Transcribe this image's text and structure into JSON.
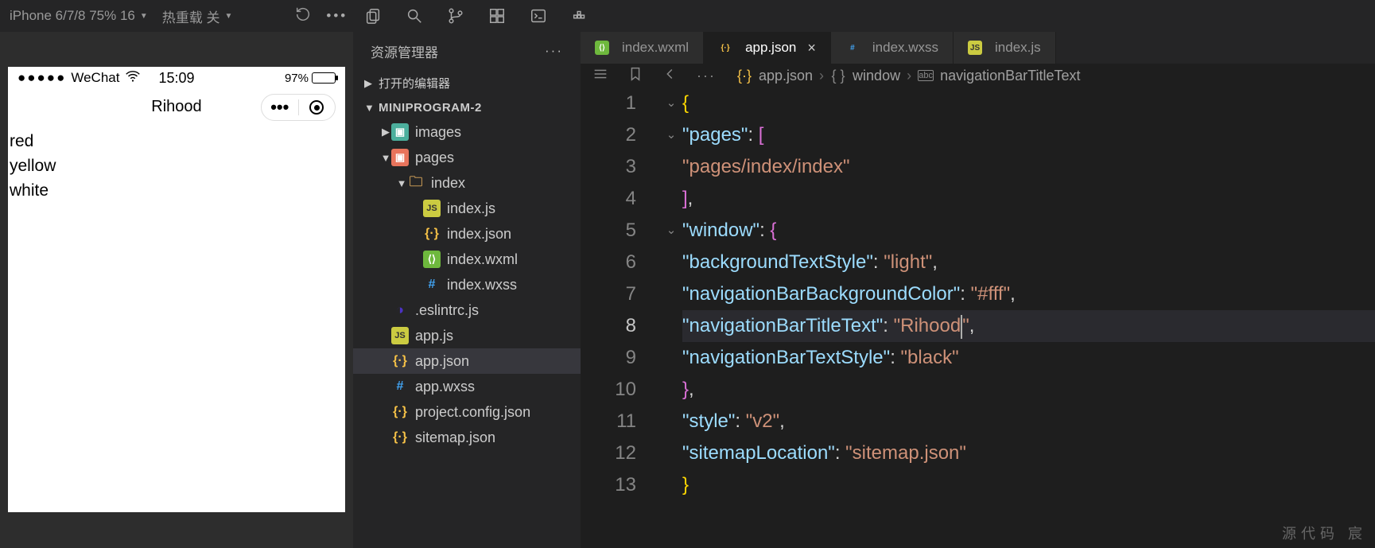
{
  "toolbar": {
    "device": "iPhone 6/7/8 75% 16",
    "hot_reload": "热重载 关"
  },
  "simulator": {
    "carrier": "WeChat",
    "time": "15:09",
    "battery": "97%",
    "title": "Rihood",
    "body_lines": [
      "red",
      "yellow",
      "white"
    ]
  },
  "explorer": {
    "title": "资源管理器",
    "open_editors": "打开的编辑器",
    "project": "MINIPROGRAM-2",
    "tree": [
      {
        "indent": 1,
        "arrow": "▶",
        "icon": "img-folder",
        "label": "images"
      },
      {
        "indent": 1,
        "arrow": "▼",
        "icon": "pages-folder",
        "label": "pages"
      },
      {
        "indent": 2,
        "arrow": "▼",
        "icon": "folder-open",
        "label": "index"
      },
      {
        "indent": 3,
        "arrow": "",
        "icon": "js",
        "label": "index.js"
      },
      {
        "indent": 3,
        "arrow": "",
        "icon": "json",
        "label": "index.json"
      },
      {
        "indent": 3,
        "arrow": "",
        "icon": "wxml",
        "label": "index.wxml"
      },
      {
        "indent": 3,
        "arrow": "",
        "icon": "wxss",
        "label": "index.wxss"
      },
      {
        "indent": 1,
        "arrow": "",
        "icon": "eslint",
        "label": ".eslintrc.js"
      },
      {
        "indent": 1,
        "arrow": "",
        "icon": "js",
        "label": "app.js"
      },
      {
        "indent": 1,
        "arrow": "",
        "icon": "json",
        "label": "app.json",
        "selected": true
      },
      {
        "indent": 1,
        "arrow": "",
        "icon": "wxss",
        "label": "app.wxss"
      },
      {
        "indent": 1,
        "arrow": "",
        "icon": "json",
        "label": "project.config.json"
      },
      {
        "indent": 1,
        "arrow": "",
        "icon": "json",
        "label": "sitemap.json"
      }
    ]
  },
  "tabs": [
    {
      "icon": "wxml",
      "label": "index.wxml",
      "active": false
    },
    {
      "icon": "json",
      "label": "app.json",
      "active": true,
      "close": true
    },
    {
      "icon": "wxss",
      "label": "index.wxss",
      "active": false
    },
    {
      "icon": "js",
      "label": "index.js",
      "active": false
    }
  ],
  "breadcrumb": {
    "file": "app.json",
    "path1": "window",
    "path2": "navigationBarTitleText"
  },
  "code": {
    "lines": [
      {
        "n": 1,
        "fold": "⌄",
        "html": "<span class='tok-brace'>{</span>"
      },
      {
        "n": 2,
        "fold": "⌄",
        "html": "  <span class='tok-key'>\"pages\"</span><span class='tok-punc'>: </span><span class='tok-bracket'>[</span>"
      },
      {
        "n": 3,
        "fold": "",
        "html": "    <span class='tok-str'>\"pages/index/index\"</span>"
      },
      {
        "n": 4,
        "fold": "",
        "html": "  <span class='tok-bracket'>]</span><span class='tok-punc'>,</span>"
      },
      {
        "n": 5,
        "fold": "⌄",
        "html": "  <span class='tok-key'>\"window\"</span><span class='tok-punc'>: </span><span class='tok-bracket'>{</span>"
      },
      {
        "n": 6,
        "fold": "",
        "html": "    <span class='tok-key'>\"backgroundTextStyle\"</span><span class='tok-punc'>: </span><span class='tok-str'>\"light\"</span><span class='tok-punc'>,</span>"
      },
      {
        "n": 7,
        "fold": "",
        "html": "    <span class='tok-key'>\"navigationBarBackgroundColor\"</span><span class='tok-punc'>: </span><span class='tok-str'>\"#fff\"</span><span class='tok-punc'>,</span>"
      },
      {
        "n": 8,
        "fold": "",
        "hl": true,
        "html": "    <span class='tok-key'>\"navigationBarTitleText\"</span><span class='tok-punc'>: </span><span class='tok-str'>\"Rihood<span class='cursor'></span>\"</span><span class='tok-punc'>,</span>"
      },
      {
        "n": 9,
        "fold": "",
        "html": "    <span class='tok-key'>\"navigationBarTextStyle\"</span><span class='tok-punc'>: </span><span class='tok-str'>\"black\"</span>"
      },
      {
        "n": 10,
        "fold": "",
        "html": "  <span class='tok-bracket'>}</span><span class='tok-punc'>,</span>"
      },
      {
        "n": 11,
        "fold": "",
        "html": "  <span class='tok-key'>\"style\"</span><span class='tok-punc'>: </span><span class='tok-str'>\"v2\"</span><span class='tok-punc'>,</span>"
      },
      {
        "n": 12,
        "fold": "",
        "html": "  <span class='tok-key'>\"sitemapLocation\"</span><span class='tok-punc'>: </span><span class='tok-str'>\"sitemap.json\"</span>"
      },
      {
        "n": 13,
        "fold": "",
        "html": "<span class='tok-brace'>}</span>"
      }
    ]
  },
  "watermark": "源代码  宸"
}
